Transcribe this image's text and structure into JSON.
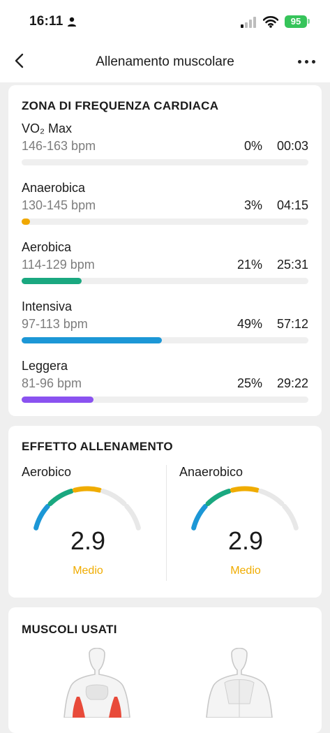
{
  "status_bar": {
    "time": "16:11",
    "battery": "95",
    "battery_color": "#36c45a"
  },
  "nav": {
    "title": "Allenamento muscolare",
    "back_icon": "chevron-left-icon",
    "more_icon": "more-horizontal-icon"
  },
  "heart_rate_zones": {
    "title": "ZONA DI FREQUENZA CARDIACA",
    "zones": [
      {
        "name": "VO₂ Max",
        "range": "146-163 bpm",
        "percent": "0%",
        "time": "00:03",
        "fill": 0,
        "color": "#e0e0e0"
      },
      {
        "name": "Anaerobica",
        "range": "130-145 bpm",
        "percent": "3%",
        "time": "04:15",
        "fill": 0.03,
        "color": "#f0a800"
      },
      {
        "name": "Aerobica",
        "range": "114-129 bpm",
        "percent": "21%",
        "time": "25:31",
        "fill": 0.21,
        "color": "#1aa880"
      },
      {
        "name": "Intensiva",
        "range": "97-113 bpm",
        "percent": "49%",
        "time": "57:12",
        "fill": 0.49,
        "color": "#1c97d6"
      },
      {
        "name": "Leggera",
        "range": "81-96 bpm",
        "percent": "25%",
        "time": "29:22",
        "fill": 0.25,
        "color": "#8a52f0"
      }
    ]
  },
  "training_effect": {
    "title": "EFFETTO ALLENAMENTO",
    "aerobic": {
      "label": "Aerobico",
      "value": "2.9",
      "level": "Medio",
      "gauge_fraction": 0.58
    },
    "anaerobic": {
      "label": "Anaerobico",
      "value": "2.9",
      "level": "Medio",
      "gauge_fraction": 0.58
    },
    "gauge_colors": [
      "#1c97d6",
      "#1aa880",
      "#f0ac00",
      "#e8e8e8"
    ],
    "level_color": "#f0ac00"
  },
  "muscles": {
    "title": "MUSCOLI USATI",
    "highlight_color": "#e84a3a"
  }
}
